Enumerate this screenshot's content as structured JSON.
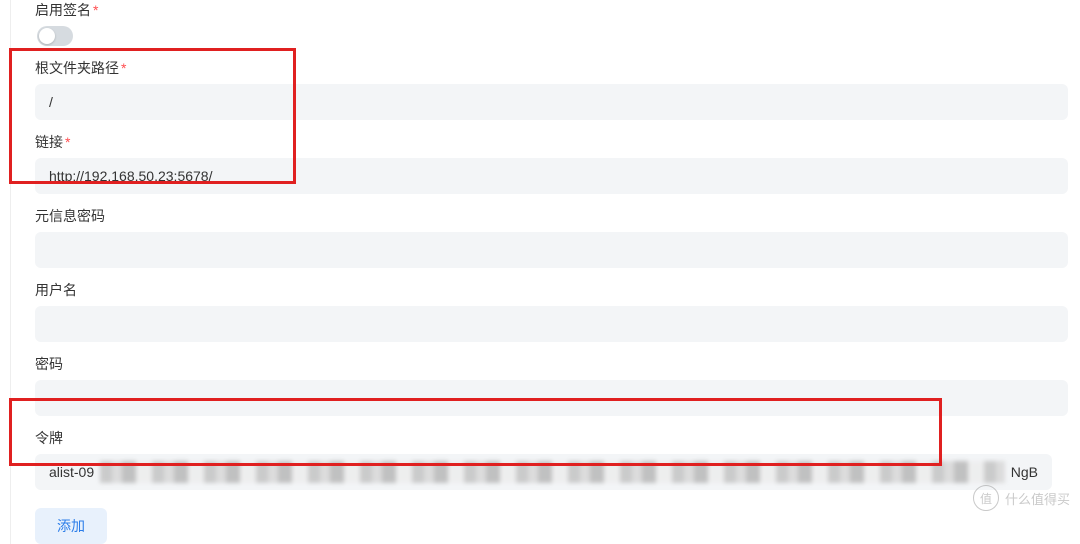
{
  "form": {
    "enable_sign": {
      "label": "启用签名",
      "required": true,
      "value": false
    },
    "root_path": {
      "label": "根文件夹路径",
      "required": true,
      "value": "/"
    },
    "link": {
      "label": "链接",
      "required": true,
      "value": "http://192.168.50.23:5678/"
    },
    "meta_password": {
      "label": "元信息密码",
      "required": false,
      "value": ""
    },
    "username": {
      "label": "用户名",
      "required": false,
      "value": ""
    },
    "password": {
      "label": "密码",
      "required": false,
      "value": ""
    },
    "token": {
      "label": "令牌",
      "required": false,
      "prefix": "alist-09",
      "suffix": "NgB"
    },
    "add_button": "添加"
  },
  "watermark": {
    "badge": "值",
    "text": "什么值得买"
  },
  "colors": {
    "required": "#ff4d4f",
    "highlight_border": "#e02020",
    "primary": "#2b7de9",
    "input_bg": "#f3f5f7"
  }
}
